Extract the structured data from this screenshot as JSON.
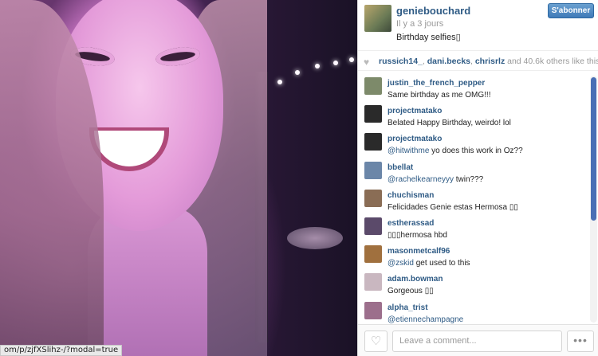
{
  "browser": {
    "status_url": "om/p/zjfXSlihz-/?modal=true"
  },
  "post": {
    "username": "geniebouchard",
    "posted_time": "Il y a 3 jours",
    "caption": "Birthday selfies▯",
    "follow_label": "S'abonner"
  },
  "likes": {
    "users": [
      "russich14_",
      "dani.becks",
      "chrisrlz"
    ],
    "suffix": "and 40.6k others like this."
  },
  "comments": [
    {
      "user": "justin_the_french_pepper",
      "mention": "",
      "text": "Same birthday as me OMG!!!",
      "avatar_color": "#7d8a6a"
    },
    {
      "user": "projectmatako",
      "mention": "",
      "text": "Belated Happy Birthday, weirdo! lol",
      "avatar_color": "#2a2a2a"
    },
    {
      "user": "projectmatako",
      "mention": "@hitwithme",
      "text": " yo does this work in Oz??",
      "avatar_color": "#2a2a2a"
    },
    {
      "user": "bbellat",
      "mention": "@rachelkearneyyy",
      "text": " twin???",
      "avatar_color": "#6b86a8"
    },
    {
      "user": "chuchisman",
      "mention": "",
      "text": "Felicidades Genie estas Hermosa ▯▯",
      "avatar_color": "#8a6d55"
    },
    {
      "user": "estherassad",
      "mention": "",
      "text": "▯▯▯hermosa hbd",
      "avatar_color": "#5b4a6a"
    },
    {
      "user": "masonmetcalf96",
      "mention": "@zskid",
      "text": " get used to this",
      "avatar_color": "#a0703e"
    },
    {
      "user": "adam.bowman",
      "mention": "",
      "text": "Gorgeous ▯▯",
      "avatar_color": "#c9b7c0"
    },
    {
      "user": "alpha_trist",
      "mention": "@etiennechampagne",
      "text": "",
      "avatar_color": "#9c6f8c"
    }
  ],
  "footer": {
    "comment_placeholder": "Leave a comment...",
    "more_label": "•••"
  },
  "colors": {
    "link": "#2f5b85",
    "follow_button": "#3f7ab8",
    "scroll_thumb": "#4a6fb5"
  }
}
